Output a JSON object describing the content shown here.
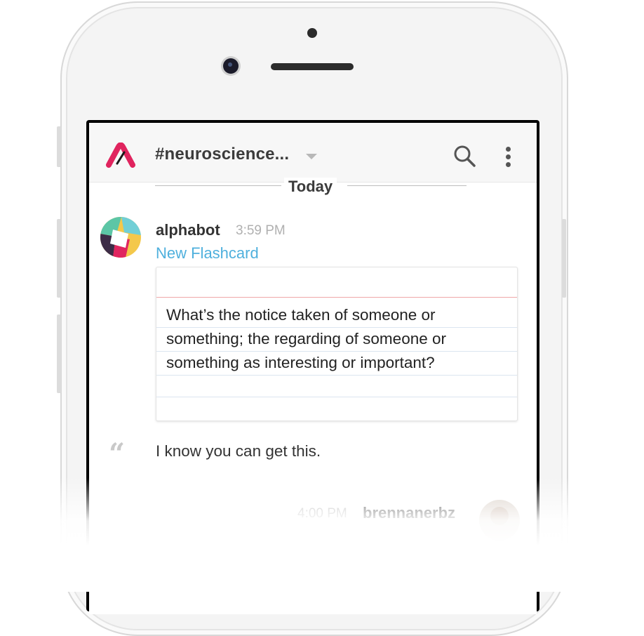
{
  "header": {
    "channel_name": "#neuroscience...",
    "search_icon": "search-icon",
    "more_icon": "more-vertical-icon",
    "logo_icon": "app-logo-icon"
  },
  "divider": {
    "label": "Today"
  },
  "message": {
    "author": "alphabot",
    "time": "3:59 PM",
    "link_text": "New Flashcard",
    "flashcard_text": "What’s the notice taken of someone or something; the regarding of someone or something as interesting or important?"
  },
  "quote": {
    "icon": "quote-icon",
    "text": "I know you can get this."
  },
  "next_message": {
    "time": "4:00 PM",
    "author": "brennanerbz"
  },
  "colors": {
    "accent": "#e0245e",
    "link": "#4fb0dd",
    "flashcard_redline": "#f0a7a9"
  }
}
